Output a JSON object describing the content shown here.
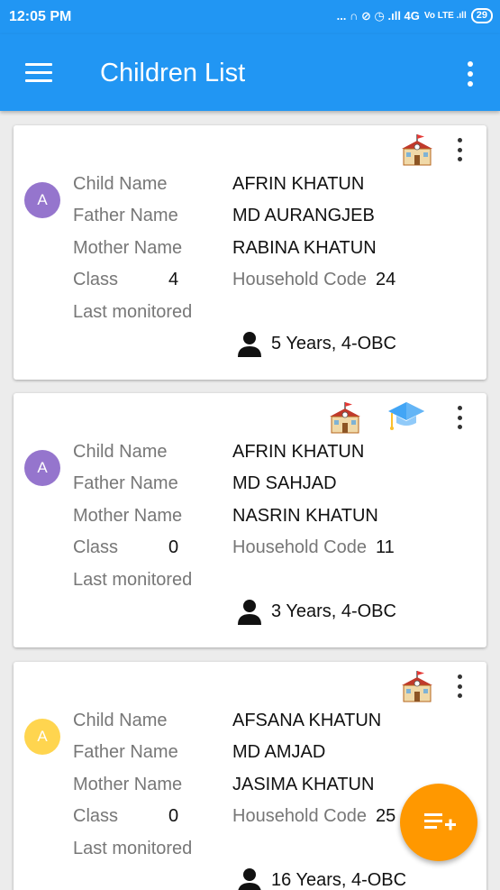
{
  "status_bar": {
    "time": "12:05 PM",
    "indicators": "... ∩ ⊘ ◷ .ıll 4G",
    "volte": "Vo LTE .ıll",
    "battery": "29"
  },
  "app_bar": {
    "title": "Children List"
  },
  "labels": {
    "child_name": "Child Name",
    "father_name": "Father Name",
    "mother_name": "Mother Name",
    "class": "Class",
    "household_code": "Household Code",
    "last_monitored": "Last monitored"
  },
  "children": [
    {
      "avatar_letter": "A",
      "avatar_color": "#9575CD",
      "child_name": "AFRIN KHATUN",
      "father_name": "MD AURANGJEB",
      "mother_name": "RABINA KHATUN",
      "class": "4",
      "household_code": "24",
      "age_category": "5 Years, 4-OBC",
      "icons": [
        "school-icon"
      ]
    },
    {
      "avatar_letter": "A",
      "avatar_color": "#9575CD",
      "child_name": "AFRIN KHATUN",
      "father_name": "MD SAHJAD",
      "mother_name": "NASRIN KHATUN",
      "class": "0",
      "household_code": "11",
      "age_category": "3 Years, 4-OBC",
      "icons": [
        "school-icon",
        "graduation-cap-icon"
      ]
    },
    {
      "avatar_letter": "A",
      "avatar_color": "#FFD54F",
      "child_name": "AFSANA KHATUN",
      "father_name": "MD AMJAD",
      "mother_name": "JASIMA KHATUN",
      "class": "0",
      "household_code": "25",
      "age_category": "16 Years, 4-OBC",
      "icons": [
        "school-icon"
      ]
    }
  ],
  "colors": {
    "primary": "#2196F3",
    "fab": "#FF9800"
  },
  "fab_icon": "add-to-list-icon"
}
